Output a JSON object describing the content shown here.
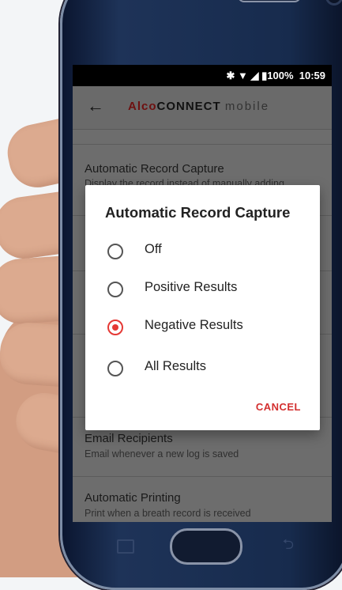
{
  "status_bar": {
    "icons": [
      "bluetooth-icon",
      "wifi-icon",
      "signal-icon",
      "battery-icon"
    ],
    "battery": "100%",
    "time": "10:59"
  },
  "app_bar": {
    "logo_alco": "Alco",
    "logo_connect": "CONNECT",
    "logo_mobile": "mobile"
  },
  "settings": [
    {
      "title": "Automatic Record Capture",
      "subtitle": "Display the record instead of manually adding"
    },
    {
      "title": "Email Recipients",
      "subtitle": "Email whenever a new log is saved"
    },
    {
      "title": "Automatic Printing",
      "subtitle": "Print when a breath record is received"
    }
  ],
  "dialog": {
    "title": "Automatic Record Capture",
    "options": [
      "Off",
      "Positive Results",
      "Negative Results",
      "All Results"
    ],
    "selected": "Negative Results",
    "cancel_label": "CANCEL"
  },
  "colors": {
    "accent": "#e53935",
    "scrim": "#6d6d6d"
  }
}
